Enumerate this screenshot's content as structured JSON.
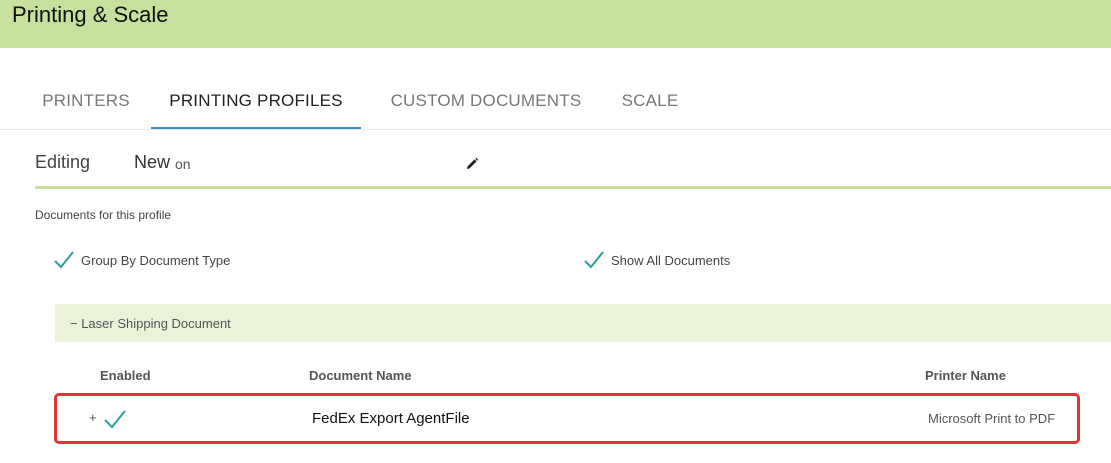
{
  "header": {
    "title": "Printing & Scale"
  },
  "tabs": [
    {
      "label": "PRINTERS",
      "active": false
    },
    {
      "label": "PRINTING PROFILES",
      "active": true
    },
    {
      "label": "CUSTOM DOCUMENTS",
      "active": false
    },
    {
      "label": "SCALE",
      "active": false
    }
  ],
  "editing": {
    "label": "Editing",
    "profile_name": "New",
    "suffix": "on",
    "edit_icon": "pencil-icon"
  },
  "documents": {
    "section_label": "Documents for this profile",
    "options": [
      {
        "label": "Group By Document Type",
        "checked": true,
        "icon": "check-icon"
      },
      {
        "label": "Show All Documents",
        "checked": true,
        "icon": "check-icon"
      }
    ],
    "group": {
      "label": "− Laser Shipping Document"
    },
    "table": {
      "headers": {
        "enabled": "Enabled",
        "document_name": "Document Name",
        "printer_name": "Printer Name"
      },
      "rows": [
        {
          "expand": "+",
          "enabled": true,
          "document_name": "FedEx Export AgentFile",
          "printer_name": "Microsoft Print to PDF"
        }
      ]
    }
  },
  "colors": {
    "header_bg": "#c6e09e",
    "accent_tab": "#3a8fc9",
    "check": "#2aa198",
    "group_bg": "#eaf3da",
    "highlight_border": "#e03535"
  }
}
